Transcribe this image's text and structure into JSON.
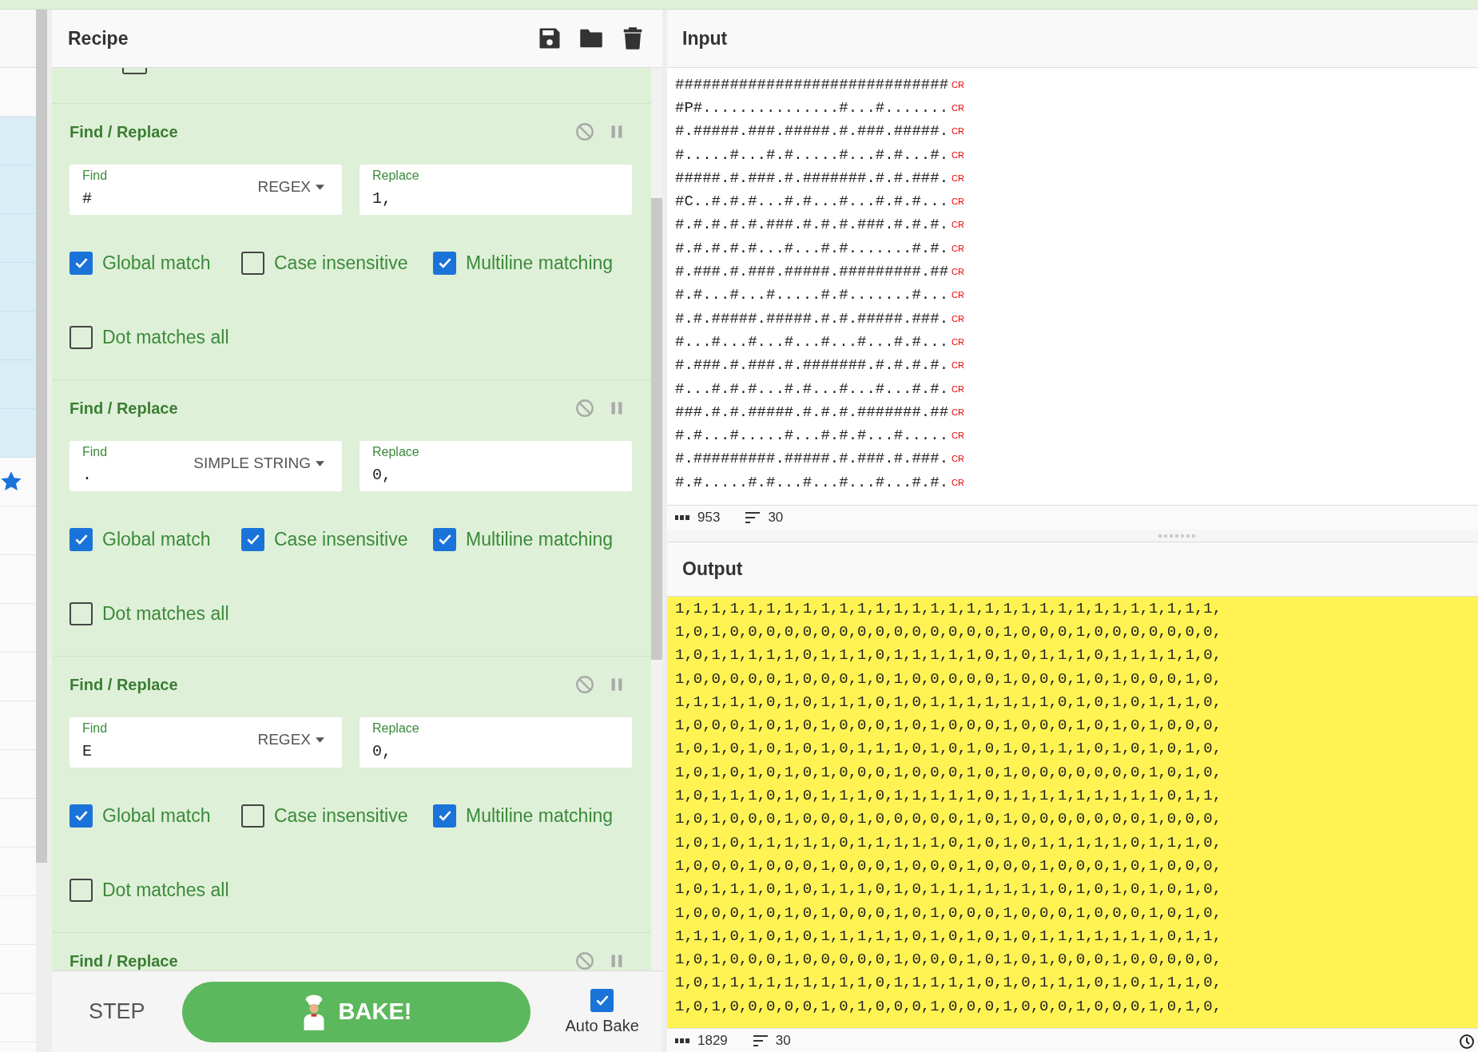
{
  "operations_strip": {
    "items": [
      {
        "highlighted": false,
        "starred": false
      },
      {
        "highlighted": true,
        "starred": false
      },
      {
        "highlighted": true,
        "starred": false
      },
      {
        "highlighted": true,
        "starred": false
      },
      {
        "highlighted": true,
        "starred": false
      },
      {
        "highlighted": true,
        "starred": false
      },
      {
        "highlighted": true,
        "starred": false
      },
      {
        "highlighted": true,
        "starred": false
      },
      {
        "highlighted": false,
        "starred": true
      },
      {
        "highlighted": false,
        "starred": false
      },
      {
        "highlighted": false,
        "starred": false
      },
      {
        "highlighted": false,
        "starred": false
      },
      {
        "highlighted": false,
        "starred": false
      },
      {
        "highlighted": false,
        "starred": false
      },
      {
        "highlighted": false,
        "starred": false
      },
      {
        "highlighted": false,
        "starred": false
      },
      {
        "highlighted": false,
        "starred": false
      },
      {
        "highlighted": false,
        "starred": false
      },
      {
        "highlighted": false,
        "starred": false
      },
      {
        "highlighted": false,
        "starred": false
      }
    ]
  },
  "recipe": {
    "title": "Recipe",
    "cut_operation": {
      "checked": false
    },
    "operations": [
      {
        "name": "Find / Replace",
        "find": {
          "label": "Find",
          "value": "#",
          "type": "REGEX"
        },
        "replace": {
          "label": "Replace",
          "value": "1,"
        },
        "options": [
          {
            "label": "Global match",
            "checked": true
          },
          {
            "label": "Case insensitive",
            "checked": false
          },
          {
            "label": "Multiline matching",
            "checked": true
          },
          {
            "label": "Dot matches all",
            "checked": false
          }
        ]
      },
      {
        "name": "Find / Replace",
        "find": {
          "label": "Find",
          "value": ".",
          "type": "SIMPLE STRING"
        },
        "replace": {
          "label": "Replace",
          "value": "0,"
        },
        "options": [
          {
            "label": "Global match",
            "checked": true
          },
          {
            "label": "Case insensitive",
            "checked": true
          },
          {
            "label": "Multiline matching",
            "checked": true
          },
          {
            "label": "Dot matches all",
            "checked": false
          }
        ]
      },
      {
        "name": "Find / Replace",
        "find": {
          "label": "Find",
          "value": "E",
          "type": "REGEX"
        },
        "replace": {
          "label": "Replace",
          "value": "0,"
        },
        "options": [
          {
            "label": "Global match",
            "checked": true
          },
          {
            "label": "Case insensitive",
            "checked": false
          },
          {
            "label": "Multiline matching",
            "checked": true
          },
          {
            "label": "Dot matches all",
            "checked": false
          }
        ]
      },
      {
        "name": "Find / Replace"
      }
    ]
  },
  "controls": {
    "step": "STEP",
    "bake": "BAKE!",
    "auto_bake": {
      "label": "Auto Bake",
      "checked": true
    }
  },
  "input": {
    "title": "Input",
    "lines": [
      {
        "text": "##############################",
        "eol": "CR"
      },
      {
        "text": "#P#...............#...#.......",
        "eol": "CR"
      },
      {
        "text": "#.#####.###.#####.#.###.#####.",
        "eol": "CR"
      },
      {
        "text": "#.....#...#.#.....#...#.#...#.",
        "eol": "CR"
      },
      {
        "text": "#####.#.###.#.#######.#.#.###.",
        "eol": "CR"
      },
      {
        "text": "#C..#.#.#...#.#...#...#.#.#...",
        "eol": "CR"
      },
      {
        "text": "#.#.#.#.#.###.#.#.#.###.#.#.#.",
        "eol": "CR"
      },
      {
        "text": "#.#.#.#.#...#...#.#.......#.#.",
        "eol": "CR"
      },
      {
        "text": "#.###.#.###.#####.#########.##",
        "eol": "CR"
      },
      {
        "text": "#.#...#...#.....#.#.......#...",
        "eol": "CR"
      },
      {
        "text": "#.#.#####.#####.#.#.#####.###.",
        "eol": "CR"
      },
      {
        "text": "#...#...#...#...#...#...#.#...",
        "eol": "CR"
      },
      {
        "text": "#.###.#.###.#.#######.#.#.#.#.",
        "eol": "CR"
      },
      {
        "text": "#...#.#.#...#.#...#...#...#.#.",
        "eol": "CR"
      },
      {
        "text": "###.#.#.#####.#.#.#.#######.##",
        "eol": "CR"
      },
      {
        "text": "#.#...#.....#...#.#.#...#.....",
        "eol": "CR"
      },
      {
        "text": "#.#########.#####.#.###.#.###.",
        "eol": "CR"
      },
      {
        "text": "#.#.....#.#...#...#...#...#.#.",
        "eol": "CR"
      }
    ],
    "status": {
      "length": "953",
      "lines": "30"
    }
  },
  "output": {
    "title": "Output",
    "lines": [
      "1,1,1,1,1,1,1,1,1,1,1,1,1,1,1,1,1,1,1,1,1,1,1,1,1,1,1,1,1,1,",
      "1,0,1,0,0,0,0,0,0,0,0,0,0,0,0,0,0,0,1,0,0,0,1,0,0,0,0,0,0,0,",
      "1,0,1,1,1,1,1,0,1,1,1,0,1,1,1,1,1,0,1,0,1,1,1,0,1,1,1,1,1,0,",
      "1,0,0,0,0,0,1,0,0,0,1,0,1,0,0,0,0,0,1,0,0,0,1,0,1,0,0,0,1,0,",
      "1,1,1,1,1,0,1,0,1,1,1,0,1,0,1,1,1,1,1,1,1,0,1,0,1,0,1,1,1,0,",
      "1,0,0,0,1,0,1,0,1,0,0,0,1,0,1,0,0,0,1,0,0,0,1,0,1,0,1,0,0,0,",
      "1,0,1,0,1,0,1,0,1,0,1,1,1,0,1,0,1,0,1,0,1,1,1,0,1,0,1,0,1,0,",
      "1,0,1,0,1,0,1,0,1,0,0,0,1,0,0,0,1,0,1,0,0,0,0,0,0,0,1,0,1,0,",
      "1,0,1,1,1,0,1,0,1,1,1,0,1,1,1,1,1,0,1,1,1,1,1,1,1,1,1,0,1,1,",
      "1,0,1,0,0,0,1,0,0,0,1,0,0,0,0,0,1,0,1,0,0,0,0,0,0,0,1,0,0,0,",
      "1,0,1,0,1,1,1,1,1,0,1,1,1,1,1,0,1,0,1,0,1,1,1,1,1,0,1,1,1,0,",
      "1,0,0,0,1,0,0,0,1,0,0,0,1,0,0,0,1,0,0,0,1,0,0,0,1,0,1,0,0,0,",
      "1,0,1,1,1,0,1,0,1,1,1,0,1,0,1,1,1,1,1,1,1,0,1,0,1,0,1,0,1,0,",
      "1,0,0,0,1,0,1,0,1,0,0,0,1,0,1,0,0,0,1,0,0,0,1,0,0,0,1,0,1,0,",
      "1,1,1,0,1,0,1,0,1,1,1,1,1,0,1,0,1,0,1,0,1,1,1,1,1,1,1,0,1,1,",
      "1,0,1,0,0,0,1,0,0,0,0,0,1,0,0,0,1,0,1,0,1,0,0,0,1,0,0,0,0,0,",
      "1,0,1,1,1,1,1,1,1,1,1,0,1,1,1,1,1,0,1,0,1,1,1,0,1,0,1,1,1,0,",
      "1,0,1,0,0,0,0,0,1,0,1,0,0,0,1,0,0,0,1,0,0,0,1,0,0,0,1,0,1,0,"
    ],
    "status": {
      "length": "1829",
      "lines": "30"
    }
  }
}
